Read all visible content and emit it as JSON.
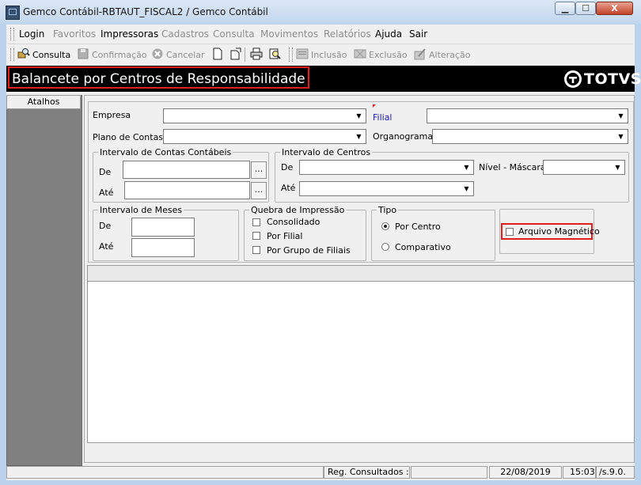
{
  "window": {
    "title": "Gemco Contábil-RBTAUT_FISCAL2 / Gemco Contábil",
    "min_glyph": "▁",
    "max_glyph": "☐",
    "close_glyph": "X"
  },
  "menu": [
    {
      "label": "Login",
      "enabled": true
    },
    {
      "label": "Favoritos",
      "enabled": false
    },
    {
      "label": "Impressoras",
      "enabled": true
    },
    {
      "label": "Cadastros",
      "enabled": false
    },
    {
      "label": "Consulta",
      "enabled": false
    },
    {
      "label": "Movimentos",
      "enabled": false
    },
    {
      "label": "Relatórios",
      "enabled": false
    },
    {
      "label": "Ajuda",
      "enabled": true
    },
    {
      "label": "Sair",
      "enabled": true
    }
  ],
  "toolbar": {
    "consulta": "Consulta",
    "confirmacao": "Confirmação",
    "cancelar": "Cancelar",
    "inclusao": "Inclusão",
    "exclusao": "Exclusão",
    "alteracao": "Alteração"
  },
  "header": {
    "title": "Balancete por Centros de Responsabilidade",
    "logo": "TOTVS"
  },
  "sidebar": {
    "atalhos": "Atalhos"
  },
  "form": {
    "empresa_label": "Empresa",
    "filial_label": "Filial",
    "plano_label": "Plano de Contas",
    "organograma_label": "Organograma",
    "contas_group": "Intervalo de Contas Contábeis",
    "centros_group": "Intervalo de Centros",
    "de": "De",
    "ate": "Até",
    "nivel_label": "Nível - Máscara",
    "ellipsis": "...",
    "meses_group": "Intervalo de Meses",
    "quebra_group": "Quebra de Impressão",
    "consolidado": "Consolidado",
    "por_filial": "Por Filial",
    "por_grupo": "Por Grupo de Filiais",
    "tipo_group": "Tipo",
    "por_centro": "Por Centro",
    "comparativo": "Comparativo",
    "arquivo": "Arquivo Magnético"
  },
  "status": {
    "reg": "Reg. Consultados : 0",
    "date": "22/08/2019",
    "time": "15:03",
    "version": "/s.9.0."
  },
  "colors": {
    "highlight_red": "#e02020",
    "banner": "#000000",
    "filial_label": "#1a1aa8"
  }
}
